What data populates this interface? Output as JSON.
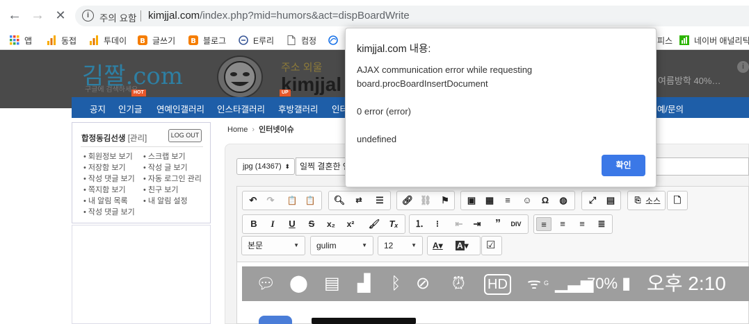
{
  "browser": {
    "security_label": "주의 요함",
    "url_domain": "kimjjal.com",
    "url_path": "/index.php?mid=humors&act=dispBoardWrite",
    "bookmarks": [
      {
        "label": "앱",
        "icon": "apps-grid-icon",
        "color": "#4285f4"
      },
      {
        "label": "동접",
        "icon": "bar-chart-icon",
        "color": "#f9ab00"
      },
      {
        "label": "투데이",
        "icon": "bar-chart-icon",
        "color": "#f9ab00"
      },
      {
        "label": "글쓰기",
        "icon": "blogger-icon",
        "color": "#f57d00"
      },
      {
        "label": "블로그",
        "icon": "blogger-icon",
        "color": "#f57d00"
      },
      {
        "label": "E루리",
        "icon": "e-circle-icon",
        "color": "#3b5998"
      },
      {
        "label": "컴정",
        "icon": "page-icon",
        "color": "#777777"
      },
      {
        "label": "",
        "icon": "globe-icon",
        "color": "#1a73e8"
      },
      {
        "label": "피스",
        "icon": "",
        "color": ""
      },
      {
        "label": "네이버 애널리틱",
        "icon": "naver-analytics-icon",
        "color": "#2db400"
      }
    ]
  },
  "site": {
    "logo": "김짤.com",
    "logo_sub": "구글에 검색하세요",
    "tagline": "주소 외울",
    "name": "kimjjal",
    "ad_text": "여름방학 40%…",
    "nav": [
      "공지",
      "인기글",
      "연예인갤러리",
      "인스타갤러리",
      "후방갤러리",
      "인터",
      "예/문의"
    ],
    "badges": [
      "HOT",
      "UP"
    ]
  },
  "sidebar": {
    "user_name": "합정동김선생",
    "admin_label": "[관리]",
    "logout_label": "LOG OUT",
    "links_left": [
      "회원정보 보기",
      "저장함 보기",
      "작성 댓글 보기",
      "쪽지함 보기",
      "내 알림 목록",
      "작성 댓글 보기"
    ],
    "links_right": [
      "스크랩 보기",
      "작성 글 보기",
      "자동 로그인 관리",
      "친구 보기",
      "내 알림 설정"
    ]
  },
  "breadcrumb": {
    "home": "Home",
    "separator": "›",
    "current": "인터넷이슈"
  },
  "editor": {
    "category_value": "jpg (14367)",
    "title_value": "일찍 결혼한 연",
    "source_label": "소스",
    "format_value": "본문",
    "font_value": "gulim",
    "size_value": "12"
  },
  "status_bar": {
    "battery": "70%",
    "time": "오후 2:10",
    "network_label": "HD",
    "signal_g": "G"
  },
  "dialog": {
    "title": "kimjjal.com 내용:",
    "line1": "AJAX communication error while requesting",
    "line2": "board.procBoardInsertDocument",
    "line3": "0 error (error)",
    "line4": "undefined",
    "ok_label": "확인",
    "ok_color": "#3b78e7"
  }
}
